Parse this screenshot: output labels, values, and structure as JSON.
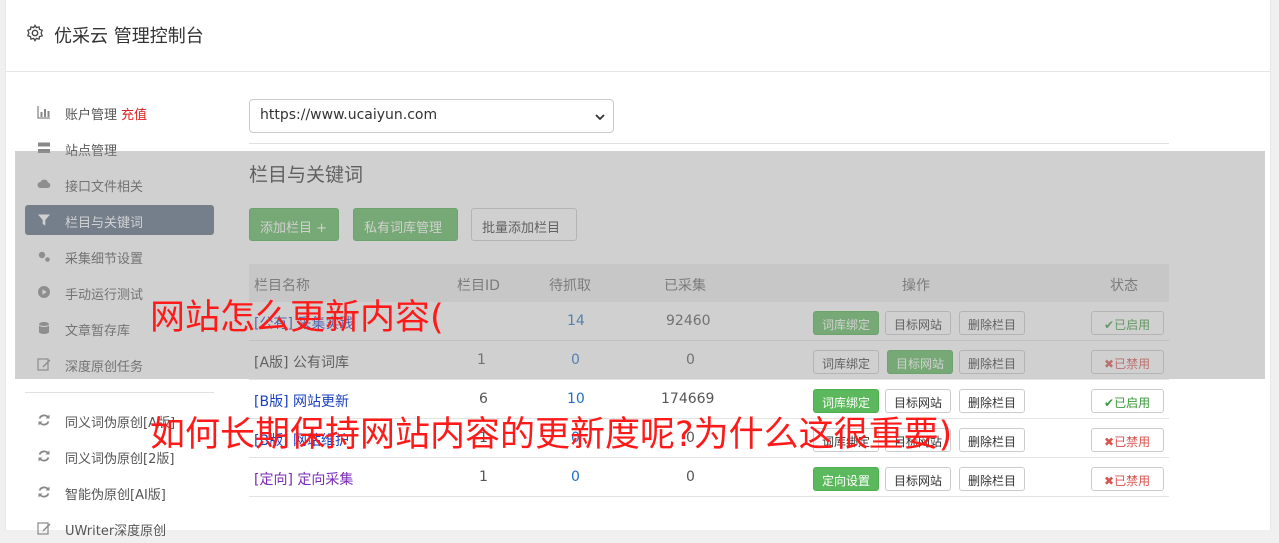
{
  "header": {
    "title": "优采云 管理控制台"
  },
  "sidebar": {
    "items": [
      {
        "label": "账户管理",
        "extra": "充值",
        "icon": "bar-chart-icon"
      },
      {
        "label": "站点管理",
        "icon": "server-icon"
      },
      {
        "label": "接口文件相关",
        "icon": "cloud-upload-icon"
      },
      {
        "label": "栏目与关键词",
        "icon": "filter-icon",
        "active": true
      },
      {
        "label": "采集细节设置",
        "icon": "cogs-icon"
      },
      {
        "label": "手动运行测试",
        "icon": "play-circle-icon"
      },
      {
        "label": "文章暂存库",
        "icon": "database-icon"
      },
      {
        "label": "深度原创任务",
        "icon": "edit-icon"
      },
      {
        "label": "同义词伪原创[A版]",
        "icon": "refresh-icon"
      },
      {
        "label": "同义词伪原创[2版]",
        "icon": "refresh-icon"
      },
      {
        "label": "智能伪原创[AI版]",
        "icon": "refresh-icon"
      },
      {
        "label": "UWriter深度原创",
        "icon": "edit-icon"
      }
    ]
  },
  "site_select": {
    "value": "https://www.ucaiyun.com"
  },
  "section": {
    "title": "栏目与关键词",
    "add_column": "添加栏目 +",
    "private_lexicon": "私有词库管理",
    "batch_add": "批量添加栏目"
  },
  "table": {
    "headers": [
      "栏目名称",
      "栏目ID",
      "待抓取",
      "已采集",
      "操作",
      "状态"
    ],
    "rows": [
      {
        "tag": "[公有]",
        "name": "采集实践",
        "id": "",
        "pending": "14",
        "collected": "92460",
        "ops": [
          "词库绑定",
          "目标网站",
          "删除栏目"
        ],
        "status": "已启用"
      },
      {
        "tag": "[A版]",
        "name": "公有词库",
        "id": "1",
        "pending": "0",
        "collected": "0",
        "ops": [
          "词库绑定",
          "目标网站",
          "删除栏目"
        ],
        "status": "已禁用"
      },
      {
        "tag": "[B版]",
        "name": "网站更新",
        "id": "6",
        "pending": "10",
        "collected": "174669",
        "ops": [
          "词库绑定",
          "目标网站",
          "删除栏目"
        ],
        "status": "已启用"
      },
      {
        "tag": "[B版]",
        "name": "网站维护",
        "id": "1",
        "pending": "0",
        "collected": "0",
        "ops": [
          "词库绑定",
          "目标网站",
          "删除栏目"
        ],
        "status": "已禁用"
      },
      {
        "tag": "[定向]",
        "name": "定向采集",
        "id": "1",
        "pending": "0",
        "collected": "0",
        "ops": [
          "定向设置",
          "目标网站",
          "删除栏目"
        ],
        "status": "已禁用"
      }
    ]
  },
  "overlay_text": {
    "line1": "网站怎么更新内容(",
    "line2": "如何长期保持网站内容的更新度呢?为什么这很重要)"
  },
  "colors": {
    "accent_green": "#5cb85c",
    "active_nav": "#5a6c84",
    "overlay_red": "#ff1a1a"
  }
}
